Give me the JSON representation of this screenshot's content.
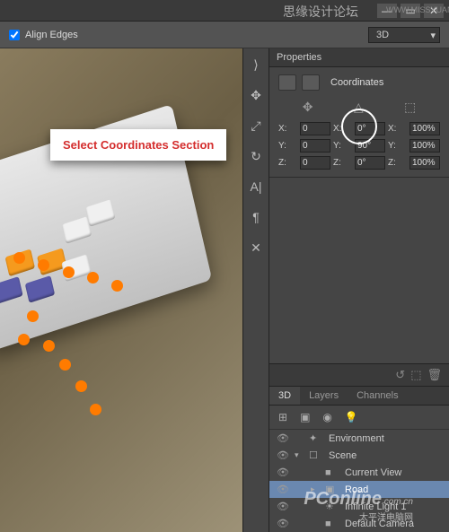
{
  "titlebar": {
    "title": "思缘设计论坛",
    "url": "WWW.MISSYUAN.COM"
  },
  "toolbar": {
    "alignEdges": "Align Edges",
    "mode": "3D"
  },
  "callout": "Select Coordinates Section",
  "properties": {
    "tab": "Properties",
    "header": "Coordinates",
    "rows": [
      {
        "axis": "X",
        "pos": "0",
        "rotLabel": "X:",
        "rot": "0°",
        "scaleLabel": "X:",
        "scale": "100%"
      },
      {
        "axis": "Y",
        "pos": "0",
        "rotLabel": "Y:",
        "rot": "90°",
        "scaleLabel": "Y:",
        "scale": "100%"
      },
      {
        "axis": "Z",
        "pos": "0",
        "rotLabel": "Z:",
        "rot": "0°",
        "scaleLabel": "Z:",
        "scale": "100%"
      }
    ]
  },
  "panel3d": {
    "tabs": [
      "3D",
      "Layers",
      "Channels"
    ],
    "activeTab": 0,
    "items": [
      {
        "icon": "✦",
        "label": "Environment",
        "indent": 0
      },
      {
        "icon": "☐",
        "label": "Scene",
        "indent": 0,
        "expand": "▾"
      },
      {
        "icon": "■",
        "label": "Current View",
        "indent": 1
      },
      {
        "icon": "▣",
        "label": "Road",
        "indent": 1,
        "expand": "▸",
        "selected": true
      },
      {
        "icon": "☀",
        "label": "Infinite Light 1",
        "indent": 1
      },
      {
        "icon": "■",
        "label": "Default Camera",
        "indent": 1
      }
    ]
  },
  "watermark": {
    "brand": "PConline",
    "domain": ".com.cn",
    "sub": "太平洋电脑网"
  }
}
